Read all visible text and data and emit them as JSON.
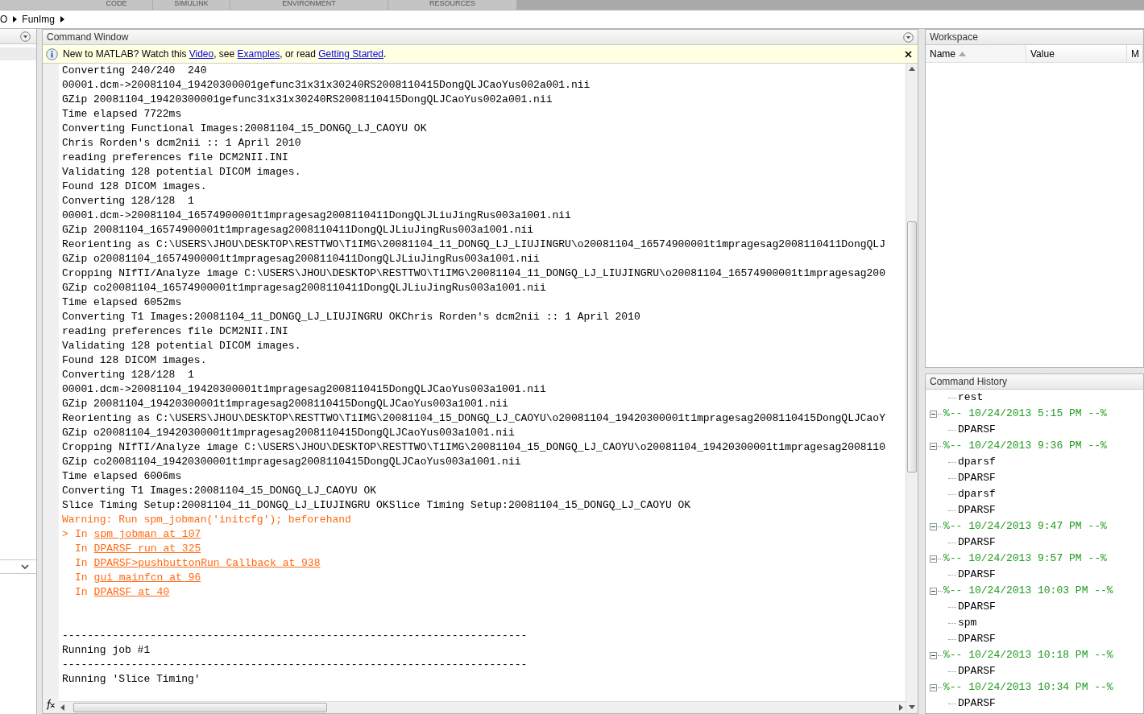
{
  "toolstrip_tabs": [
    "CODE",
    "SIMULINK",
    "ENVIRONMENT",
    "RESOURCES"
  ],
  "path": [
    "O",
    "FunImg"
  ],
  "command_window": {
    "title": "Command Window",
    "info": [
      {
        "kind": "text",
        "text": "New to MATLAB? Watch this "
      },
      {
        "kind": "link",
        "text": "Video"
      },
      {
        "kind": "text",
        "text": ", see "
      },
      {
        "kind": "link",
        "text": "Examples"
      },
      {
        "kind": "text",
        "text": ", or read "
      },
      {
        "kind": "link",
        "text": "Getting Started"
      },
      {
        "kind": "text",
        "text": "."
      }
    ],
    "lines": [
      {
        "kind": "text",
        "text": "Converting 240/240  240"
      },
      {
        "kind": "text",
        "text": "00001.dcm->20081104_19420300001gefunc31x31x30240RS2008110415DongQLJCaoYus002a001.nii"
      },
      {
        "kind": "text",
        "text": "GZip 20081104_19420300001gefunc31x31x30240RS2008110415DongQLJCaoYus002a001.nii"
      },
      {
        "kind": "text",
        "text": "Time elapsed 7722ms"
      },
      {
        "kind": "text",
        "text": "Converting Functional Images:20081104_15_DONGQ_LJ_CAOYU OK"
      },
      {
        "kind": "text",
        "text": "Chris Rorden's dcm2nii :: 1 April 2010"
      },
      {
        "kind": "text",
        "text": "reading preferences file DCM2NII.INI"
      },
      {
        "kind": "text",
        "text": "Validating 128 potential DICOM images."
      },
      {
        "kind": "text",
        "text": "Found 128 DICOM images."
      },
      {
        "kind": "text",
        "text": "Converting 128/128  1"
      },
      {
        "kind": "text",
        "text": "00001.dcm->20081104_16574900001t1mpragesag2008110411DongQLJLiuJingRus003a1001.nii"
      },
      {
        "kind": "text",
        "text": "GZip 20081104_16574900001t1mpragesag2008110411DongQLJLiuJingRus003a1001.nii"
      },
      {
        "kind": "text",
        "text": "Reorienting as C:\\USERS\\JHOU\\DESKTOP\\RESTTWO\\T1IMG\\20081104_11_DONGQ_LJ_LIUJINGRU\\o20081104_16574900001t1mpragesag2008110411DongQLJ"
      },
      {
        "kind": "text",
        "text": "GZip o20081104_16574900001t1mpragesag2008110411DongQLJLiuJingRus003a1001.nii"
      },
      {
        "kind": "text",
        "text": "Cropping NIfTI/Analyze image C:\\USERS\\JHOU\\DESKTOP\\RESTTWO\\T1IMG\\20081104_11_DONGQ_LJ_LIUJINGRU\\o20081104_16574900001t1mpragesag200"
      },
      {
        "kind": "text",
        "text": "GZip co20081104_16574900001t1mpragesag2008110411DongQLJLiuJingRus003a1001.nii"
      },
      {
        "kind": "text",
        "text": "Time elapsed 6052ms"
      },
      {
        "kind": "text",
        "text": "Converting T1 Images:20081104_11_DONGQ_LJ_LIUJINGRU OKChris Rorden's dcm2nii :: 1 April 2010"
      },
      {
        "kind": "text",
        "text": "reading preferences file DCM2NII.INI"
      },
      {
        "kind": "text",
        "text": "Validating 128 potential DICOM images."
      },
      {
        "kind": "text",
        "text": "Found 128 DICOM images."
      },
      {
        "kind": "text",
        "text": "Converting 128/128  1"
      },
      {
        "kind": "text",
        "text": "00001.dcm->20081104_19420300001t1mpragesag2008110415DongQLJCaoYus003a1001.nii"
      },
      {
        "kind": "text",
        "text": "GZip 20081104_19420300001t1mpragesag2008110415DongQLJCaoYus003a1001.nii"
      },
      {
        "kind": "text",
        "text": "Reorienting as C:\\USERS\\JHOU\\DESKTOP\\RESTTWO\\T1IMG\\20081104_15_DONGQ_LJ_CAOYU\\o20081104_19420300001t1mpragesag2008110415DongQLJCaoY"
      },
      {
        "kind": "text",
        "text": "GZip o20081104_19420300001t1mpragesag2008110415DongQLJCaoYus003a1001.nii"
      },
      {
        "kind": "text",
        "text": "Cropping NIfTI/Analyze image C:\\USERS\\JHOU\\DESKTOP\\RESTTWO\\T1IMG\\20081104_15_DONGQ_LJ_CAOYU\\o20081104_19420300001t1mpragesag2008110"
      },
      {
        "kind": "text",
        "text": "GZip co20081104_19420300001t1mpragesag2008110415DongQLJCaoYus003a1001.nii"
      },
      {
        "kind": "text",
        "text": "Time elapsed 6006ms"
      },
      {
        "kind": "text",
        "text": "Converting T1 Images:20081104_15_DONGQ_LJ_CAOYU OK"
      },
      {
        "kind": "text",
        "text": "Slice Timing Setup:20081104_11_DONGQ_LJ_LIUJINGRU OKSlice Timing Setup:20081104_15_DONGQ_LJ_CAOYU OK"
      },
      {
        "kind": "warning",
        "text": "Warning: Run spm_jobman('initcfg'); beforehand"
      },
      {
        "kind": "trace",
        "marker": ">",
        "text": "In",
        "link": "spm_jobman at 107"
      },
      {
        "kind": "trace",
        "text": "In",
        "link": "DPARSF_run at 325"
      },
      {
        "kind": "trace",
        "text": "In",
        "link": "DPARSF>pushbuttonRun_Callback at 938"
      },
      {
        "kind": "trace",
        "text": "In",
        "link": "gui_mainfcn at 96"
      },
      {
        "kind": "trace",
        "text": "In",
        "link": "DPARSF at 40"
      },
      {
        "kind": "blank"
      },
      {
        "kind": "blank"
      },
      {
        "kind": "text",
        "text": "--------------------------------------------------------------------------"
      },
      {
        "kind": "text",
        "text": "Running job #1"
      },
      {
        "kind": "text",
        "text": "--------------------------------------------------------------------------"
      },
      {
        "kind": "text",
        "text": "Running 'Slice Timing'"
      }
    ]
  },
  "workspace": {
    "title": "Workspace",
    "columns": [
      {
        "label": "Name",
        "sorted": true
      },
      {
        "label": "Value"
      },
      {
        "label": "M"
      }
    ]
  },
  "command_history": {
    "title": "Command History",
    "items": [
      {
        "kind": "command",
        "text": "rest"
      },
      {
        "kind": "session",
        "text": "%-- 10/24/2013 5:15 PM --%",
        "expanded": true,
        "children": [
          {
            "text": "DPARSF"
          }
        ]
      },
      {
        "kind": "session",
        "text": "%-- 10/24/2013 9:36 PM --%",
        "expanded": true,
        "children": [
          {
            "text": "dparsf"
          },
          {
            "text": "DPARSF"
          },
          {
            "text": "dparsf"
          },
          {
            "text": "DPARSF"
          }
        ]
      },
      {
        "kind": "session",
        "text": "%-- 10/24/2013 9:47 PM --%",
        "expanded": true,
        "children": [
          {
            "text": "DPARSF"
          }
        ]
      },
      {
        "kind": "session",
        "text": "%-- 10/24/2013 9:57 PM --%",
        "expanded": true,
        "children": [
          {
            "text": "DPARSF"
          }
        ]
      },
      {
        "kind": "session",
        "text": "%-- 10/24/2013 10:03 PM --%",
        "expanded": true,
        "children": [
          {
            "text": "DPARSF"
          },
          {
            "text": "spm"
          },
          {
            "text": "DPARSF"
          }
        ]
      },
      {
        "kind": "session",
        "text": "%-- 10/24/2013 10:18 PM --%",
        "expanded": true,
        "children": [
          {
            "text": "DPARSF"
          }
        ]
      },
      {
        "kind": "session",
        "text": "%-- 10/24/2013 10:34 PM --%",
        "expanded": true,
        "children": [
          {
            "text": "DPARSF"
          }
        ]
      }
    ]
  }
}
